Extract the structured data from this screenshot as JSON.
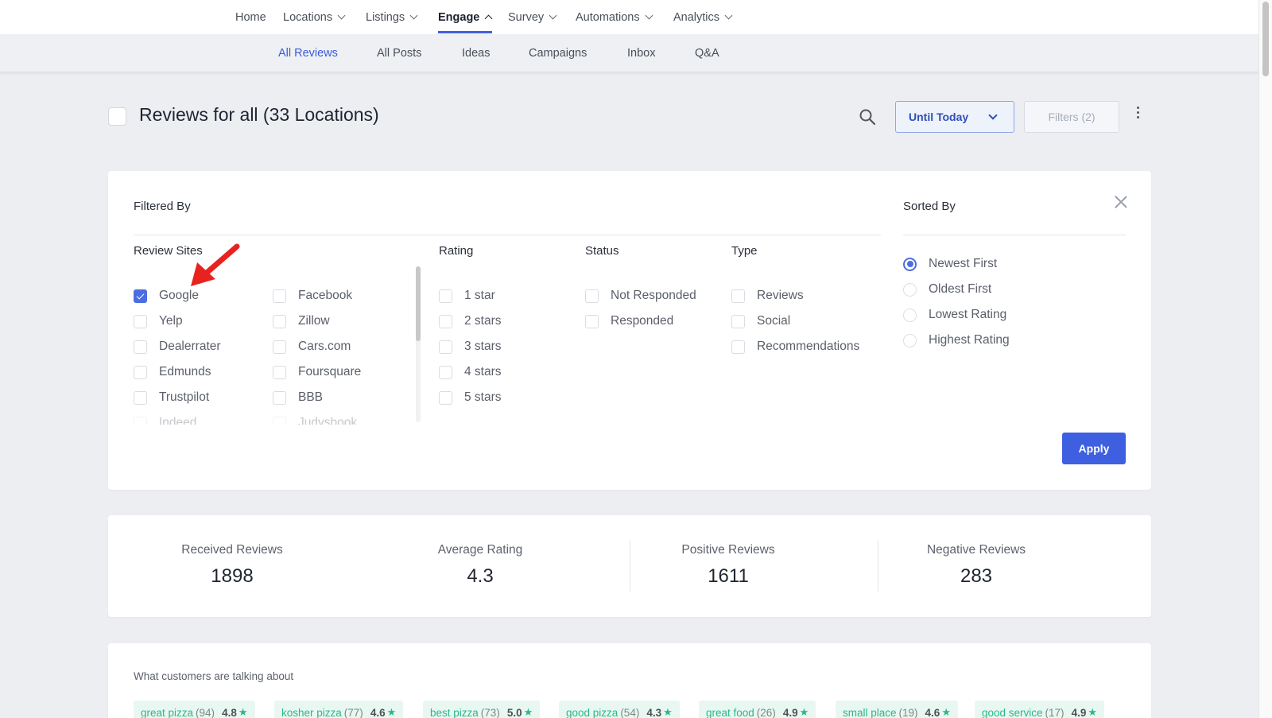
{
  "topnav": {
    "items": [
      {
        "label": "Home",
        "has_chevron": false,
        "active": false
      },
      {
        "label": "Locations",
        "has_chevron": true,
        "active": false
      },
      {
        "label": "Listings",
        "has_chevron": true,
        "active": false
      },
      {
        "label": "Engage",
        "has_chevron": true,
        "active": true
      },
      {
        "label": "Survey",
        "has_chevron": true,
        "active": false
      },
      {
        "label": "Automations",
        "has_chevron": true,
        "active": false
      },
      {
        "label": "Analytics",
        "has_chevron": true,
        "active": false
      }
    ]
  },
  "subnav": {
    "tabs": [
      {
        "label": "All Reviews",
        "active": true
      },
      {
        "label": "All Posts",
        "active": false
      },
      {
        "label": "Ideas",
        "active": false
      },
      {
        "label": "Campaigns",
        "active": false
      },
      {
        "label": "Inbox",
        "active": false
      },
      {
        "label": "Q&A",
        "active": false
      }
    ]
  },
  "header": {
    "title": "Reviews for all (33 Locations)",
    "date_range_label": "Until Today",
    "filters_label": "Filters (2)"
  },
  "filter_panel": {
    "filtered_by_label": "Filtered By",
    "sorted_by_label": "Sorted By",
    "review_sites": {
      "label": "Review Sites",
      "col1": [
        {
          "label": "Google",
          "checked": true
        },
        {
          "label": "Yelp",
          "checked": false
        },
        {
          "label": "Dealerrater",
          "checked": false
        },
        {
          "label": "Edmunds",
          "checked": false
        },
        {
          "label": "Trustpilot",
          "checked": false
        },
        {
          "label": "Indeed",
          "checked": false
        }
      ],
      "col2": [
        {
          "label": "Facebook",
          "checked": false
        },
        {
          "label": "Zillow",
          "checked": false
        },
        {
          "label": "Cars.com",
          "checked": false
        },
        {
          "label": "Foursquare",
          "checked": false
        },
        {
          "label": "BBB",
          "checked": false
        },
        {
          "label": "Judysbook",
          "checked": false
        }
      ]
    },
    "rating": {
      "label": "Rating",
      "options": [
        "1 star",
        "2 stars",
        "3 stars",
        "4 stars",
        "5 stars"
      ]
    },
    "status": {
      "label": "Status",
      "options": [
        "Not Responded",
        "Responded"
      ]
    },
    "type": {
      "label": "Type",
      "options": [
        "Reviews",
        "Social",
        "Recommendations"
      ]
    },
    "sort": {
      "options": [
        {
          "label": "Newest First",
          "selected": true
        },
        {
          "label": "Oldest First",
          "selected": false
        },
        {
          "label": "Lowest Rating",
          "selected": false
        },
        {
          "label": "Highest Rating",
          "selected": false
        }
      ]
    },
    "apply_label": "Apply"
  },
  "stats": [
    {
      "title": "Received Reviews",
      "value": "1898"
    },
    {
      "title": "Average Rating",
      "value": "4.3"
    },
    {
      "title": "Positive Reviews",
      "value": "1611"
    },
    {
      "title": "Negative Reviews",
      "value": "283"
    }
  ],
  "talking": {
    "title": "What customers are talking about",
    "tags": [
      {
        "term": "great pizza",
        "count": "(94)",
        "rating": "4.8"
      },
      {
        "term": "kosher pizza",
        "count": "(77)",
        "rating": "4.6"
      },
      {
        "term": "best pizza",
        "count": "(73)",
        "rating": "5.0"
      },
      {
        "term": "good pizza",
        "count": "(54)",
        "rating": "4.3"
      },
      {
        "term": "great food",
        "count": "(26)",
        "rating": "4.9"
      },
      {
        "term": "small place",
        "count": "(19)",
        "rating": "4.6"
      },
      {
        "term": "good service",
        "count": "(17)",
        "rating": "4.9"
      }
    ]
  },
  "colors": {
    "accent": "#3d5fe0",
    "tag_green": "#29b88a",
    "annotation_arrow": "#e8231f"
  },
  "icons": [
    "search-icon",
    "chevron-down-icon",
    "kebab-menu-icon",
    "close-icon",
    "star-icon",
    "annotation-arrow"
  ]
}
